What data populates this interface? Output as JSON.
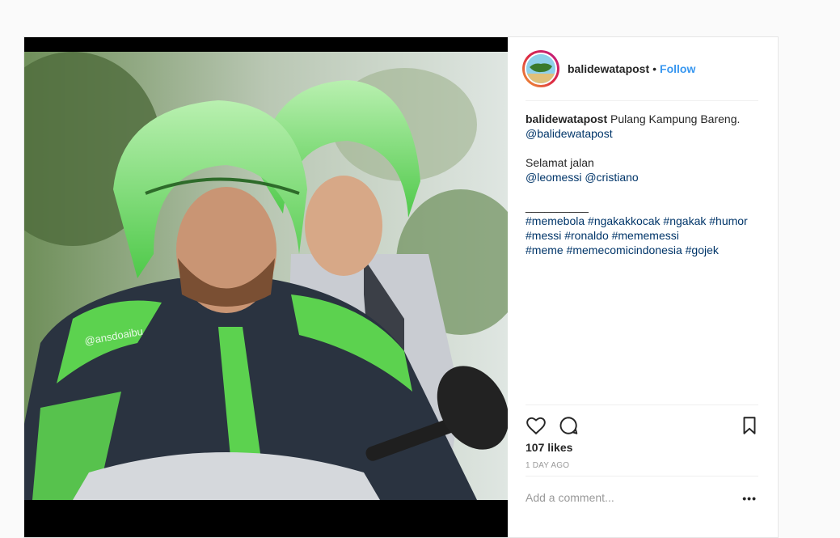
{
  "post": {
    "username": "balidewatapost",
    "separator": "•",
    "follow_label": "Follow",
    "photo_watermark": "@ansdoaibu",
    "caption": {
      "username": "balidewatapost",
      "line1": "Pulang Kampung Bareng.",
      "mention_1": "@balidewatapost",
      "line3": "Selamat jalan",
      "mention_2": "@leomessi",
      "mention_3": "@cristiano",
      "divider": "__________",
      "hashtags_line1": "#memebola #ngakakkocak #ngakak #humor",
      "hashtags_line2": "#messi #ronaldo #mememessi",
      "hashtags_line3": "#meme #memecomicindonesia #gojek"
    },
    "likes": "107 likes",
    "time": "1 DAY AGO",
    "comment_placeholder": "Add a comment...",
    "more_label": "•••"
  },
  "icons": [
    "heart-icon",
    "comment-icon",
    "bookmark-icon",
    "more-icon"
  ],
  "colors": {
    "follow": "#3897f0",
    "link": "#003569",
    "jacket_green": "#5cd24f",
    "jacket_dark": "#2a3340"
  }
}
